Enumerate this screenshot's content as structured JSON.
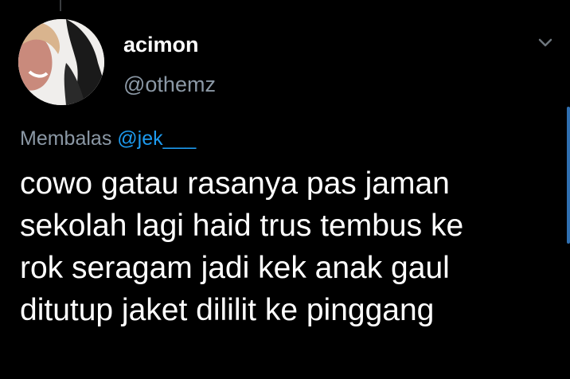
{
  "author": {
    "display_name": "acimon",
    "handle": "@othemz"
  },
  "reply": {
    "prefix": "Membalas",
    "mention": "@jek___"
  },
  "tweet": {
    "lines": [
      "cowo gatau rasanya pas jaman",
      "sekolah lagi haid trus tembus ke",
      "rok seragam jadi kek anak gaul",
      "ditutup jaket dililit ke pinggang"
    ]
  },
  "icons": {
    "menu": "chevron-down-icon"
  },
  "colors": {
    "background": "#000000",
    "text": "#ffffff",
    "secondary": "#8b98a5",
    "link": "#1d9bf0"
  }
}
